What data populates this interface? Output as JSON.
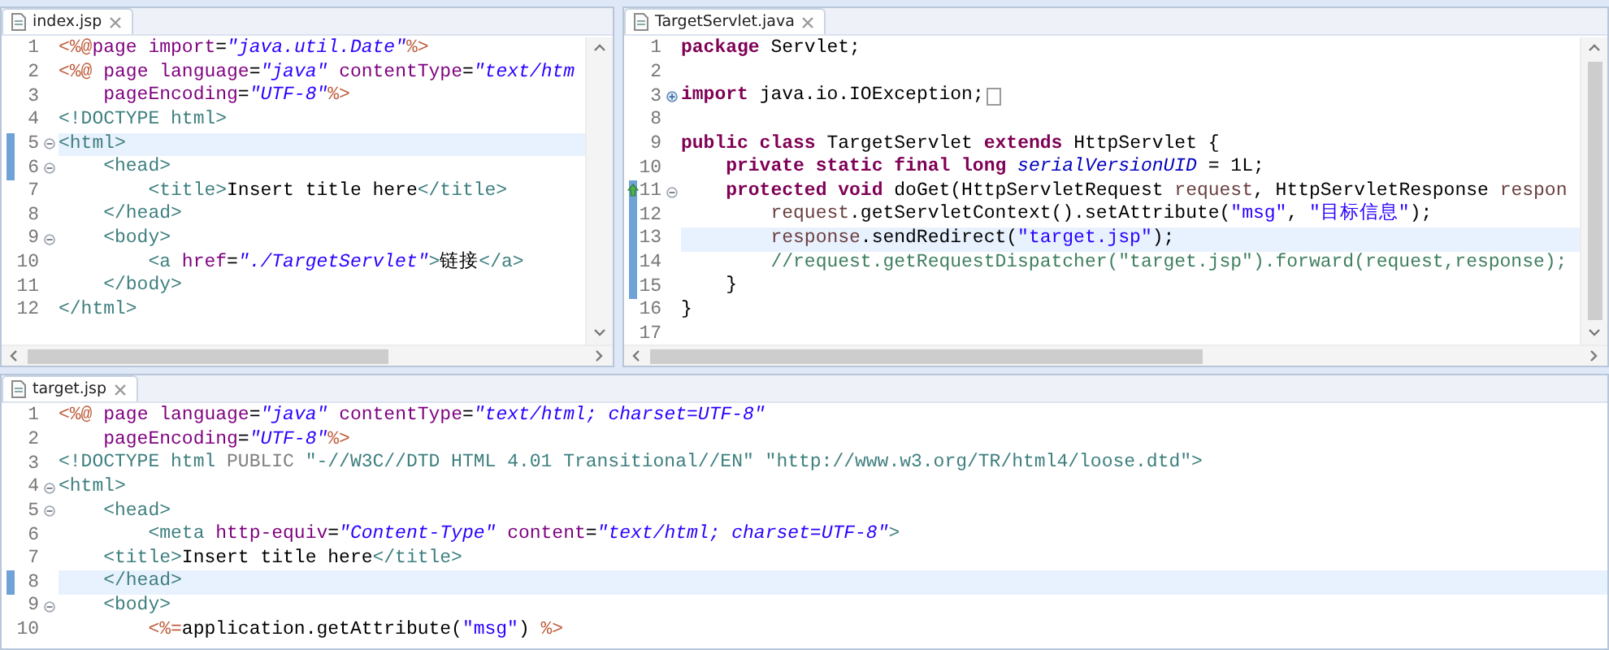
{
  "editors": [
    {
      "tab": {
        "label": "index.jsp"
      },
      "lines": [
        {
          "number": "1",
          "current": false,
          "marker": false,
          "override": false,
          "collapsible": false,
          "collapsed": false,
          "tokens": [
            {
              "kind": "directive",
              "text": "<%@"
            },
            {
              "kind": "attr",
              "text": "page import"
            },
            {
              "kind": "plain",
              "text": "="
            },
            {
              "kind": "str",
              "text": "\"java.util.Date\""
            },
            {
              "kind": "directive",
              "text": "%>"
            }
          ]
        },
        {
          "number": "2",
          "current": false,
          "marker": false,
          "override": false,
          "collapsible": false,
          "collapsed": false,
          "tokens": [
            {
              "kind": "directive",
              "text": "<%@"
            },
            {
              "kind": "attr",
              "text": " page language"
            },
            {
              "kind": "plain",
              "text": "="
            },
            {
              "kind": "str",
              "text": "\"java\""
            },
            {
              "kind": "attr",
              "text": " contentType"
            },
            {
              "kind": "plain",
              "text": "="
            },
            {
              "kind": "str",
              "text": "\"text/htm"
            }
          ]
        },
        {
          "number": "3",
          "current": false,
          "marker": false,
          "override": false,
          "collapsible": false,
          "collapsed": false,
          "tokens": [
            {
              "kind": "attr",
              "text": "    pageEncoding"
            },
            {
              "kind": "plain",
              "text": "="
            },
            {
              "kind": "str",
              "text": "\"UTF-8\""
            },
            {
              "kind": "directive",
              "text": "%>"
            }
          ]
        },
        {
          "number": "4",
          "current": false,
          "marker": false,
          "override": false,
          "collapsible": false,
          "collapsed": false,
          "tokens": [
            {
              "kind": "tag",
              "text": "<!DOCTYPE html>"
            }
          ]
        },
        {
          "number": "5",
          "current": true,
          "marker": true,
          "override": false,
          "collapsible": true,
          "collapsed": false,
          "tokens": [
            {
              "kind": "tag",
              "text": "<html>"
            }
          ]
        },
        {
          "number": "6",
          "current": false,
          "marker": true,
          "override": false,
          "collapsible": true,
          "collapsed": false,
          "tokens": [
            {
              "kind": "tag",
              "text": "    <head>"
            }
          ]
        },
        {
          "number": "7",
          "current": false,
          "marker": false,
          "override": false,
          "collapsible": false,
          "collapsed": false,
          "tokens": [
            {
              "kind": "tag",
              "text": "        <title>"
            },
            {
              "kind": "plain",
              "text": "Insert title here"
            },
            {
              "kind": "tag",
              "text": "</title>"
            }
          ]
        },
        {
          "number": "8",
          "current": false,
          "marker": false,
          "override": false,
          "collapsible": false,
          "collapsed": false,
          "tokens": [
            {
              "kind": "tag",
              "text": "    </head>"
            }
          ]
        },
        {
          "number": "9",
          "current": false,
          "marker": false,
          "override": false,
          "collapsible": true,
          "collapsed": false,
          "tokens": [
            {
              "kind": "tag",
              "text": "    <body>"
            }
          ]
        },
        {
          "number": "10",
          "current": false,
          "marker": false,
          "override": false,
          "collapsible": false,
          "collapsed": false,
          "tokens": [
            {
              "kind": "tag",
              "text": "        <a "
            },
            {
              "kind": "attr",
              "text": "href"
            },
            {
              "kind": "plain",
              "text": "="
            },
            {
              "kind": "str",
              "text": "\"./TargetServlet\""
            },
            {
              "kind": "tag",
              "text": ">"
            },
            {
              "kind": "plain",
              "text": "链接"
            },
            {
              "kind": "tag",
              "text": "</a>"
            }
          ]
        },
        {
          "number": "11",
          "current": false,
          "marker": false,
          "override": false,
          "collapsible": false,
          "collapsed": false,
          "tokens": [
            {
              "kind": "tag",
              "text": "    </body>"
            }
          ]
        },
        {
          "number": "12",
          "current": false,
          "marker": false,
          "override": false,
          "collapsible": false,
          "collapsed": false,
          "tokens": [
            {
              "kind": "tag",
              "text": "</html>"
            }
          ]
        }
      ]
    },
    {
      "tab": {
        "label": "TargetServlet.java"
      },
      "lines": [
        {
          "number": "1",
          "current": false,
          "marker": false,
          "override": false,
          "collapsible": false,
          "collapsed": false,
          "tokens": [
            {
              "kind": "kw",
              "text": "package"
            },
            {
              "kind": "plain",
              "text": " Servlet;"
            }
          ]
        },
        {
          "number": "2",
          "current": false,
          "marker": false,
          "override": false,
          "collapsible": false,
          "collapsed": false
        },
        {
          "number": "3",
          "current": false,
          "marker": false,
          "override": false,
          "collapsible": true,
          "collapsed": true,
          "tokens": [
            {
              "kind": "kw",
              "text": "import"
            },
            {
              "kind": "plain",
              "text": " java.io.IOException;"
            }
          ]
        },
        {
          "number": "8",
          "current": false,
          "marker": false,
          "override": false,
          "collapsible": false,
          "collapsed": false
        },
        {
          "number": "9",
          "current": false,
          "marker": false,
          "override": false,
          "collapsible": false,
          "collapsed": false,
          "tokens": [
            {
              "kind": "kw",
              "text": "public class"
            },
            {
              "kind": "plain",
              "text": " TargetServlet "
            },
            {
              "kind": "kw",
              "text": "extends"
            },
            {
              "kind": "plain",
              "text": " HttpServlet {"
            }
          ]
        },
        {
          "number": "10",
          "current": false,
          "marker": false,
          "override": false,
          "collapsible": false,
          "collapsed": false,
          "tokens": [
            {
              "kind": "kw",
              "text": "    private static final long"
            },
            {
              "kind": "field",
              "text": " serialVersionUID"
            },
            {
              "kind": "plain",
              "text": " = 1L;"
            }
          ]
        },
        {
          "number": "11",
          "current": false,
          "marker": true,
          "override": true,
          "collapsible": true,
          "collapsed": false,
          "tokens": [
            {
              "kind": "kw",
              "text": "    protected void"
            },
            {
              "kind": "plain",
              "text": " doGet(HttpServletRequest "
            },
            {
              "kind": "var",
              "text": "request"
            },
            {
              "kind": "plain",
              "text": ", HttpServletResponse "
            },
            {
              "kind": "var",
              "text": "respon"
            }
          ]
        },
        {
          "number": "12",
          "current": false,
          "marker": true,
          "override": false,
          "collapsible": false,
          "collapsed": false,
          "tokens": [
            {
              "kind": "var",
              "text": "        request"
            },
            {
              "kind": "plain",
              "text": ".getServletContext().setAttribute("
            },
            {
              "kind": "jstr",
              "text": "\"msg\""
            },
            {
              "kind": "plain",
              "text": ", "
            },
            {
              "kind": "jstr",
              "text": "\"目标信息\""
            },
            {
              "kind": "plain",
              "text": ");"
            }
          ]
        },
        {
          "number": "13",
          "current": true,
          "marker": true,
          "override": false,
          "collapsible": false,
          "collapsed": false,
          "tokens": [
            {
              "kind": "var",
              "text": "        response"
            },
            {
              "kind": "plain",
              "text": ".sendRedirect("
            },
            {
              "kind": "jstr",
              "text": "\"target.jsp\""
            },
            {
              "kind": "plain",
              "text": ");"
            }
          ]
        },
        {
          "number": "14",
          "current": false,
          "marker": true,
          "override": false,
          "collapsible": false,
          "collapsed": false,
          "tokens": [
            {
              "kind": "comment",
              "text": "        //request.getRequestDispatcher(\"target.jsp\").forward(request,response);"
            }
          ]
        },
        {
          "number": "15",
          "current": false,
          "marker": true,
          "override": false,
          "collapsible": false,
          "collapsed": false,
          "tokens": [
            {
              "kind": "plain",
              "text": "    }"
            }
          ]
        },
        {
          "number": "16",
          "current": false,
          "marker": false,
          "override": false,
          "collapsible": false,
          "collapsed": false,
          "tokens": [
            {
              "kind": "plain",
              "text": "}"
            }
          ]
        },
        {
          "number": "17",
          "current": false,
          "marker": false,
          "override": false,
          "collapsible": false,
          "collapsed": false
        }
      ]
    },
    {
      "tab": {
        "label": "target.jsp"
      },
      "lines": [
        {
          "number": "1",
          "current": false,
          "marker": false,
          "override": false,
          "collapsible": false,
          "collapsed": false,
          "tokens": [
            {
              "kind": "directive",
              "text": "<%@"
            },
            {
              "kind": "attr",
              "text": " page language"
            },
            {
              "kind": "plain",
              "text": "="
            },
            {
              "kind": "str",
              "text": "\"java\""
            },
            {
              "kind": "attr",
              "text": " contentType"
            },
            {
              "kind": "plain",
              "text": "="
            },
            {
              "kind": "str",
              "text": "\"text/html; charset=UTF-8\""
            }
          ]
        },
        {
          "number": "2",
          "current": false,
          "marker": false,
          "override": false,
          "collapsible": false,
          "collapsed": false,
          "tokens": [
            {
              "kind": "attr",
              "text": "    pageEncoding"
            },
            {
              "kind": "plain",
              "text": "="
            },
            {
              "kind": "str",
              "text": "\"UTF-8\""
            },
            {
              "kind": "directive",
              "text": "%>"
            }
          ]
        },
        {
          "number": "3",
          "current": false,
          "marker": false,
          "override": false,
          "collapsible": false,
          "collapsed": false,
          "tokens": [
            {
              "kind": "tag",
              "text": "<!DOCTYPE html "
            },
            {
              "kind": "doc",
              "text": "PUBLIC "
            },
            {
              "kind": "tag",
              "text": "\"-//W3C//DTD HTML 4.01 Transitional//EN\" \"http://www.w3.org/TR/html4/loose.dtd\">"
            }
          ]
        },
        {
          "number": "4",
          "current": false,
          "marker": false,
          "override": false,
          "collapsible": true,
          "collapsed": false,
          "tokens": [
            {
              "kind": "tag",
              "text": "<html>"
            }
          ]
        },
        {
          "number": "5",
          "current": false,
          "marker": false,
          "override": false,
          "collapsible": true,
          "collapsed": false,
          "tokens": [
            {
              "kind": "tag",
              "text": "    <head>"
            }
          ]
        },
        {
          "number": "6",
          "current": false,
          "marker": false,
          "override": false,
          "collapsible": false,
          "collapsed": false,
          "tokens": [
            {
              "kind": "tag",
              "text": "        <meta "
            },
            {
              "kind": "attr",
              "text": "http-equiv"
            },
            {
              "kind": "plain",
              "text": "="
            },
            {
              "kind": "str",
              "text": "\"Content-Type\""
            },
            {
              "kind": "attr",
              "text": " content"
            },
            {
              "kind": "plain",
              "text": "="
            },
            {
              "kind": "str",
              "text": "\"text/html; charset=UTF-8\""
            },
            {
              "kind": "tag",
              "text": ">"
            }
          ]
        },
        {
          "number": "7",
          "current": false,
          "marker": false,
          "override": false,
          "collapsible": false,
          "collapsed": false,
          "tokens": [
            {
              "kind": "tag",
              "text": "    <title>"
            },
            {
              "kind": "plain",
              "text": "Insert title here"
            },
            {
              "kind": "tag",
              "text": "</title>"
            }
          ]
        },
        {
          "number": "8",
          "current": true,
          "marker": true,
          "override": false,
          "collapsible": false,
          "collapsed": false,
          "tokens": [
            {
              "kind": "tag",
              "text": "    </head>"
            }
          ]
        },
        {
          "number": "9",
          "current": false,
          "marker": false,
          "override": false,
          "collapsible": true,
          "collapsed": false,
          "tokens": [
            {
              "kind": "tag",
              "text": "    <body>"
            }
          ]
        },
        {
          "number": "10",
          "current": false,
          "marker": false,
          "override": false,
          "collapsible": false,
          "collapsed": false,
          "tokens": [
            {
              "kind": "directive",
              "text": "        <%="
            },
            {
              "kind": "plain",
              "text": "application.getAttribute("
            },
            {
              "kind": "jstr",
              "text": "\"msg\""
            },
            {
              "kind": "plain",
              "text": ") "
            },
            {
              "kind": "directive",
              "text": "%>"
            }
          ]
        }
      ]
    }
  ]
}
